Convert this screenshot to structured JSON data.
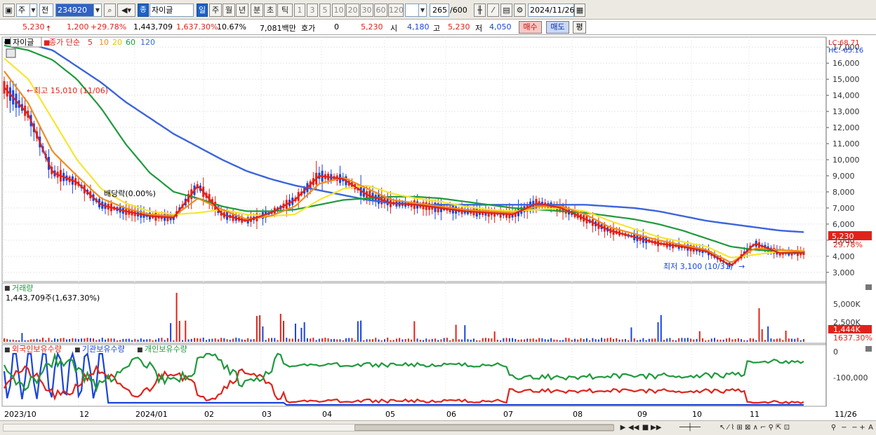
{
  "toolbar": {
    "period_label": "주",
    "prev_label": "전",
    "code": "234920",
    "badge": "종",
    "name": "자이글",
    "timeframes": [
      "일",
      "주",
      "월",
      "년",
      "분",
      "초",
      "틱"
    ],
    "minutes": [
      "1",
      "3",
      "5",
      "10",
      "20",
      "30",
      "60",
      "120"
    ],
    "count": "265",
    "count_total": "/600",
    "date": "2024/11/26"
  },
  "quote": {
    "price": "5,230",
    "change": "1,200",
    "change_pct": "+29.78%",
    "volume": "1,443,709",
    "vol_ratio": "1,637.30%",
    "turnover": "10.67%",
    "amount": "7,081백만",
    "ask_label": "호가",
    "ask_value": "0",
    "ask_price": "5,230",
    "open_label": "시",
    "open": "4,180",
    "high_label": "고",
    "high": "5,230",
    "low_label": "저",
    "low": "4,050",
    "buy": "매수",
    "sell": "매도",
    "eval": "평"
  },
  "price_panel": {
    "name_tag": "자이글",
    "legend": [
      "종가 단순",
      "5",
      "10",
      "20",
      "60",
      "120"
    ],
    "lc": "LC:68.71",
    "hc": "HC:-65.16",
    "y_ticks": [
      "17,000",
      "16,000",
      "15,000",
      "14,000",
      "13,000",
      "12,000",
      "11,000",
      "10,000",
      "9,000",
      "8,000",
      "7,000",
      "6,000",
      "5,000",
      "4,000",
      "3,000"
    ],
    "high_note": "최고 15,010 (11/06)",
    "div_note": "배당락(0.00%)",
    "low_note": "최저 3,100 (10/31)",
    "cur_price": "5,230",
    "cur_pct": "29.78%"
  },
  "volume_panel": {
    "title": "거래량",
    "value": "1,443,709주(1,637.30%)",
    "ticks": [
      "5,000K",
      "2,500K"
    ],
    "cur": "1,444K",
    "cur_pct": "1637.30%"
  },
  "holdings_panel": {
    "foreign": "외국인보유수량",
    "inst": "기관보유수량",
    "indiv": "개인보유수량",
    "ticks": [
      "0",
      "-100,000"
    ]
  },
  "x_axis": [
    "2023/10",
    "12",
    "2024/01",
    "02",
    "03",
    "04",
    "05",
    "06",
    "07",
    "08",
    "09",
    "10",
    "11",
    "11/26"
  ],
  "colors": {
    "up": "#e0231a",
    "down": "#1a44d9",
    "ma5": "#e0231a",
    "ma10": "#f08c1e",
    "ma20": "#f5e632",
    "ma60": "#1e9a3c",
    "ma120": "#3c64dc"
  },
  "chart_data": {
    "type": "line",
    "title": "",
    "series": [
      {
        "name": "5",
        "values": [
          14500,
          12800,
          9200,
          8600,
          7200,
          6800,
          6500,
          6400,
          8400,
          6600,
          6200,
          6700,
          7500,
          9000,
          8800,
          7800,
          7300,
          7200,
          7000,
          6800,
          6700,
          6600,
          7300,
          7000,
          6300,
          5600,
          5200,
          4800,
          4600,
          4300,
          3400,
          4800,
          4200,
          4200
        ]
      },
      {
        "name": "10",
        "values": [
          15500,
          13500,
          10500,
          9000,
          7600,
          7000,
          6600,
          6500,
          7600,
          6900,
          6300,
          6500,
          7100,
          8500,
          8900,
          8200,
          7500,
          7300,
          7100,
          6900,
          6800,
          6700,
          7100,
          7100,
          6600,
          5800,
          5400,
          5000,
          4700,
          4400,
          3600,
          4500,
          4400,
          4300
        ]
      },
      {
        "name": "20",
        "values": [
          16300,
          15000,
          12500,
          10000,
          8200,
          7300,
          6800,
          6600,
          6700,
          6900,
          6600,
          6500,
          6600,
          7500,
          8200,
          8400,
          7900,
          7600,
          7400,
          7100,
          6900,
          6800,
          6900,
          7000,
          6800,
          6200,
          5700,
          5200,
          4900,
          4600,
          3900,
          4100,
          4300,
          4350
        ]
      },
      {
        "name": "60",
        "values": [
          17100,
          16800,
          16200,
          15000,
          13200,
          11000,
          9200,
          8000,
          7600,
          7100,
          6800,
          6800,
          6900,
          7200,
          7500,
          7600,
          7700,
          7700,
          7600,
          7400,
          7200,
          7000,
          6900,
          6800,
          6700,
          6500,
          6300,
          6000,
          5600,
          5100,
          4600,
          4400,
          4300,
          4250
        ]
      },
      {
        "name": "120",
        "values": [
          17300,
          17200,
          16800,
          15800,
          14800,
          13600,
          12600,
          11600,
          10800,
          10000,
          9300,
          8800,
          8400,
          8100,
          7800,
          7500,
          7300,
          7200,
          7200,
          7200,
          7200,
          7200,
          7200,
          7200,
          7200,
          7100,
          7000,
          6800,
          6500,
          6200,
          6000,
          5800,
          5600,
          5500
        ]
      }
    ],
    "ylim": [
      2600,
      17400
    ]
  }
}
